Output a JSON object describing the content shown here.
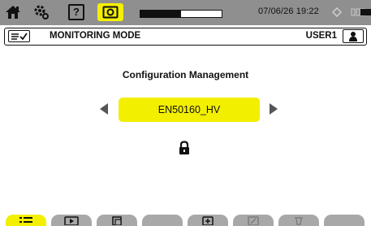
{
  "status_bar": {
    "icons": [
      "home-icon",
      "gear-icon",
      "help-icon",
      "camera-icon",
      "diamond-icon",
      "grid-icon",
      "battery-icon"
    ],
    "help_glyph": "?",
    "progress": 0.5,
    "datetime": "07/06/26 19:22",
    "colors": {
      "bar_bg": "#8f8f8f",
      "accent_yellow": "#f4f000"
    }
  },
  "title_bar": {
    "mode_icon": "checklist-icon",
    "title": "MONITORING MODE",
    "user": "USER1",
    "user_icon": "user-icon"
  },
  "main": {
    "heading": "Configuration Management",
    "selected_configuration": "EN50160_HV",
    "prev_icon": "arrow-left-icon",
    "next_icon": "arrow-right-icon",
    "lock_icon": "lock-icon",
    "colors": {
      "selector": "#f2ef00"
    }
  },
  "softkeys": [
    {
      "icon": "list-icon",
      "active": true
    },
    {
      "icon": "play-icon",
      "active": false
    },
    {
      "icon": "copy-icon",
      "active": false
    },
    {
      "icon": "blank-icon",
      "active": false
    },
    {
      "icon": "add-icon",
      "active": false
    },
    {
      "icon": "edit-icon",
      "active": false
    },
    {
      "icon": "delete-icon",
      "active": false
    },
    {
      "icon": "blank-icon",
      "active": false
    }
  ]
}
